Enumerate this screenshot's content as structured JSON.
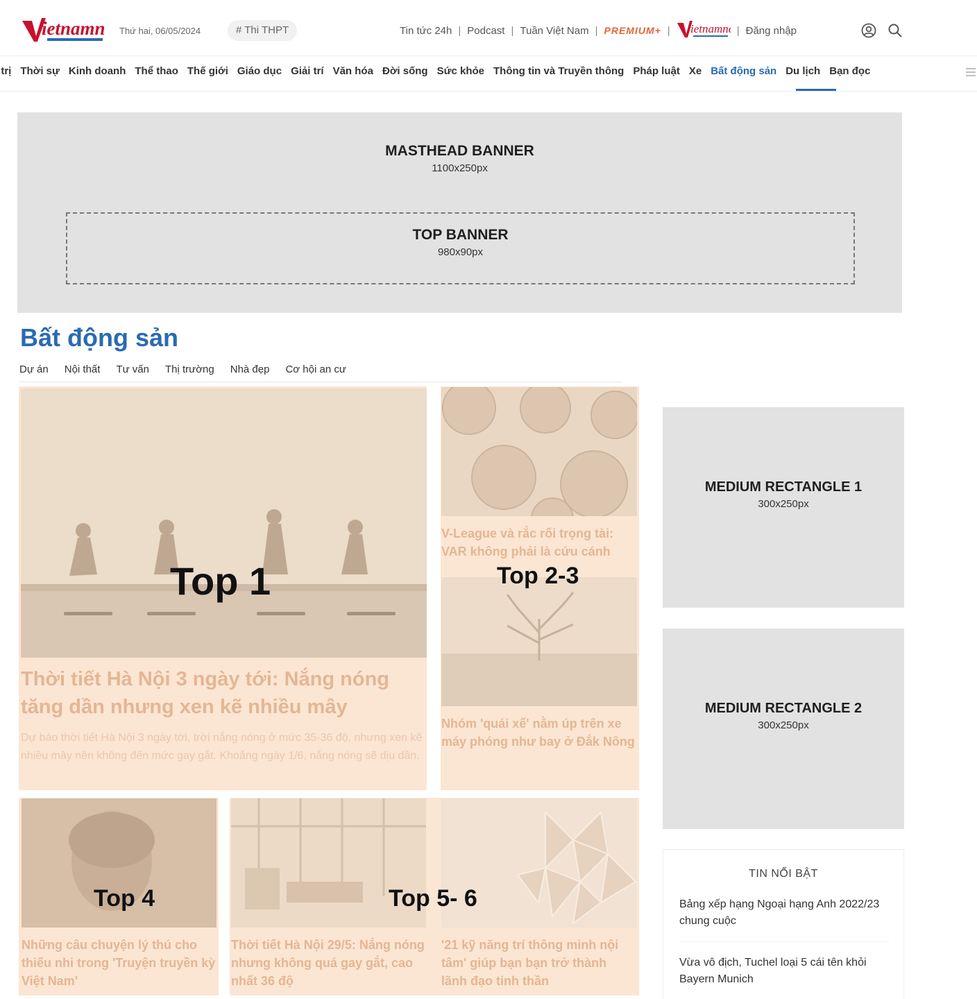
{
  "header": {
    "logo_text": "vietnamnet",
    "date": "Thứ hai, 06/05/2024",
    "tag": "# Thi THPT",
    "links": [
      "Tin tức 24h",
      "Podcast",
      "Tuần Việt Nam"
    ],
    "premium": "PREMIUM+",
    "login": "Đăng nhập"
  },
  "categories": [
    {
      "label": "h trị"
    },
    {
      "label": "Thời sự"
    },
    {
      "label": "Kinh doanh"
    },
    {
      "label": "Thể thao"
    },
    {
      "label": "Thế giới"
    },
    {
      "label": "Giáo dục"
    },
    {
      "label": "Giải trí"
    },
    {
      "label": "Văn hóa"
    },
    {
      "label": "Đời sống"
    },
    {
      "label": "Sức khỏe"
    },
    {
      "label": "Thông tin và Truyền thông"
    },
    {
      "label": "Pháp luật"
    },
    {
      "label": "Xe"
    },
    {
      "label": "Bất động sản",
      "active": true
    },
    {
      "label": "Du lịch"
    },
    {
      "label": "Bạn đọc"
    }
  ],
  "masthead": {
    "title": "MASTHEAD BANNER",
    "size": "1100x250px"
  },
  "top_banner": {
    "title": "TOP BANNER",
    "size": "980x90px"
  },
  "section": {
    "title": "Bất động sản",
    "subcategories": [
      "Dự án",
      "Nội thất",
      "Tư vấn",
      "Thị trường",
      "Nhà đẹp",
      "Cơ hội an cư"
    ]
  },
  "articles": {
    "top1": {
      "label": "Top 1",
      "title": "Thời tiết Hà Nội 3 ngày tới: Nắng nóng tăng dần nhưng xen kẽ nhiều mây",
      "desc": "Dự báo thời tiết Hà Nội 3 ngày tới, trời nắng nóng ở mức 35-36 độ, nhưng xen kẽ nhiều mây nên không đến mức gay gắt. Khoảng ngày 1/6, nắng nóng sẽ dịu dần."
    },
    "top23": {
      "label": "Top 2-3",
      "title1": "V-League và rắc rối trọng tài: VAR không phải là cứu cánh",
      "title2": "Nhóm 'quái xế' nằm úp trên xe máy phóng như bay ở Đắk Nông"
    },
    "top4": {
      "label": "Top 4",
      "title": "Những câu chuyện lý thú cho thiếu nhi trong 'Truyện truyền kỳ Việt Nam'"
    },
    "top56": {
      "label": "Top 5- 6",
      "title1": "Thời tiết Hà Nội 29/5: Nắng nóng nhưng không quá gay gắt, cao nhất 36 độ",
      "title2": "'21 kỹ năng trí thông minh nội tâm' giúp bạn bạn trở thành lãnh đạo tinh thần"
    }
  },
  "sidebar": {
    "rect1": {
      "title": "MEDIUM RECTANGLE 1",
      "size": "300x250px"
    },
    "rect2": {
      "title": "MEDIUM RECTANGLE 2",
      "size": "300x250px"
    },
    "hot": {
      "title": "TIN NỔI BẬT",
      "items": [
        "Bảng xếp hạng Ngoại hạng Anh 2022/23 chung cuộc",
        "Vừa vô địch, Tuchel loại 5 cái tên khỏi Bayern Munich"
      ]
    }
  },
  "colors": {
    "brand_blue": "#2a6ab3",
    "brand_red": "#c8102e",
    "premium": "#e0673a",
    "ad_gray": "#e2e2e2",
    "peach": "#fbe6d3"
  }
}
